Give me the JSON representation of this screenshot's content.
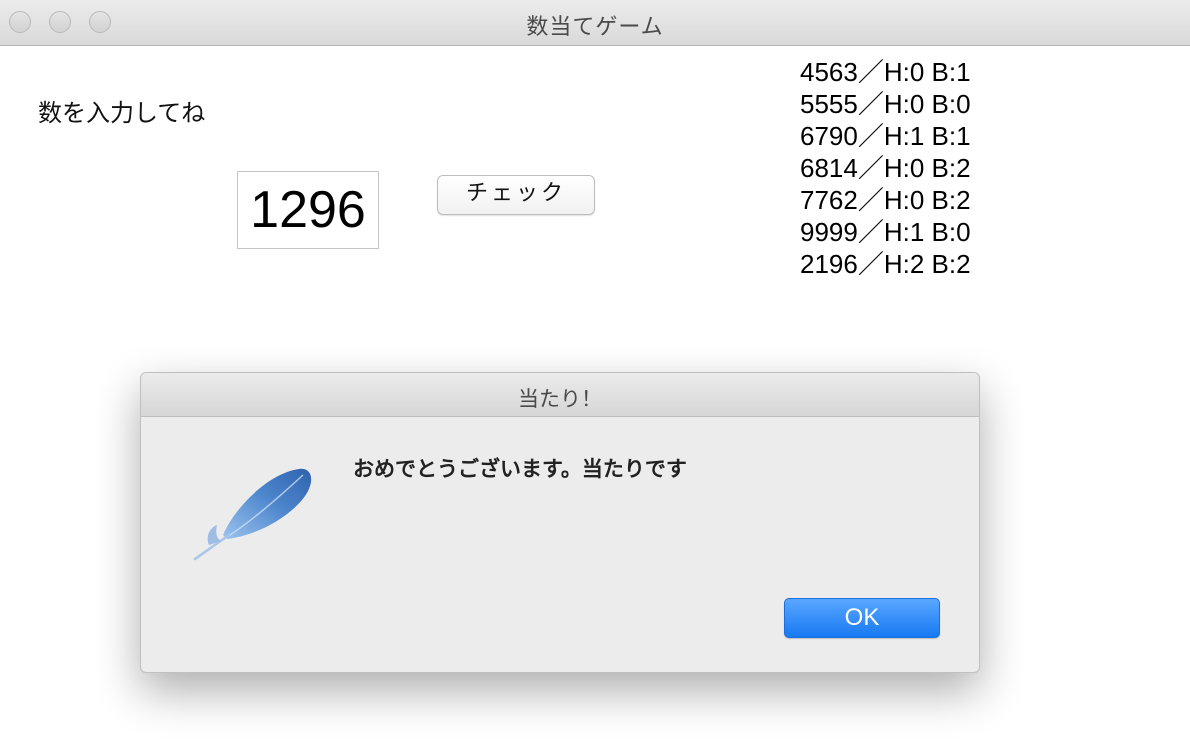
{
  "window": {
    "title": "数当てゲーム"
  },
  "main": {
    "prompt_label": "数を入力してね",
    "input_value": "1296",
    "check_button_label": "チェック"
  },
  "history": [
    "4563／H:0 B:1",
    "5555／H:0 B:0",
    "6790／H:1 B:1",
    "6814／H:0 B:2",
    "7762／H:0 B:2",
    "9999／H:1 B:0",
    "2196／H:2 B:2"
  ],
  "dialog": {
    "title": "当たり！",
    "message": "おめでとうございます。当たりです",
    "ok_label": "OK",
    "icon": "feather-icon"
  },
  "colors": {
    "ok_button": "#1779f2",
    "feather": "#4a80c8"
  }
}
